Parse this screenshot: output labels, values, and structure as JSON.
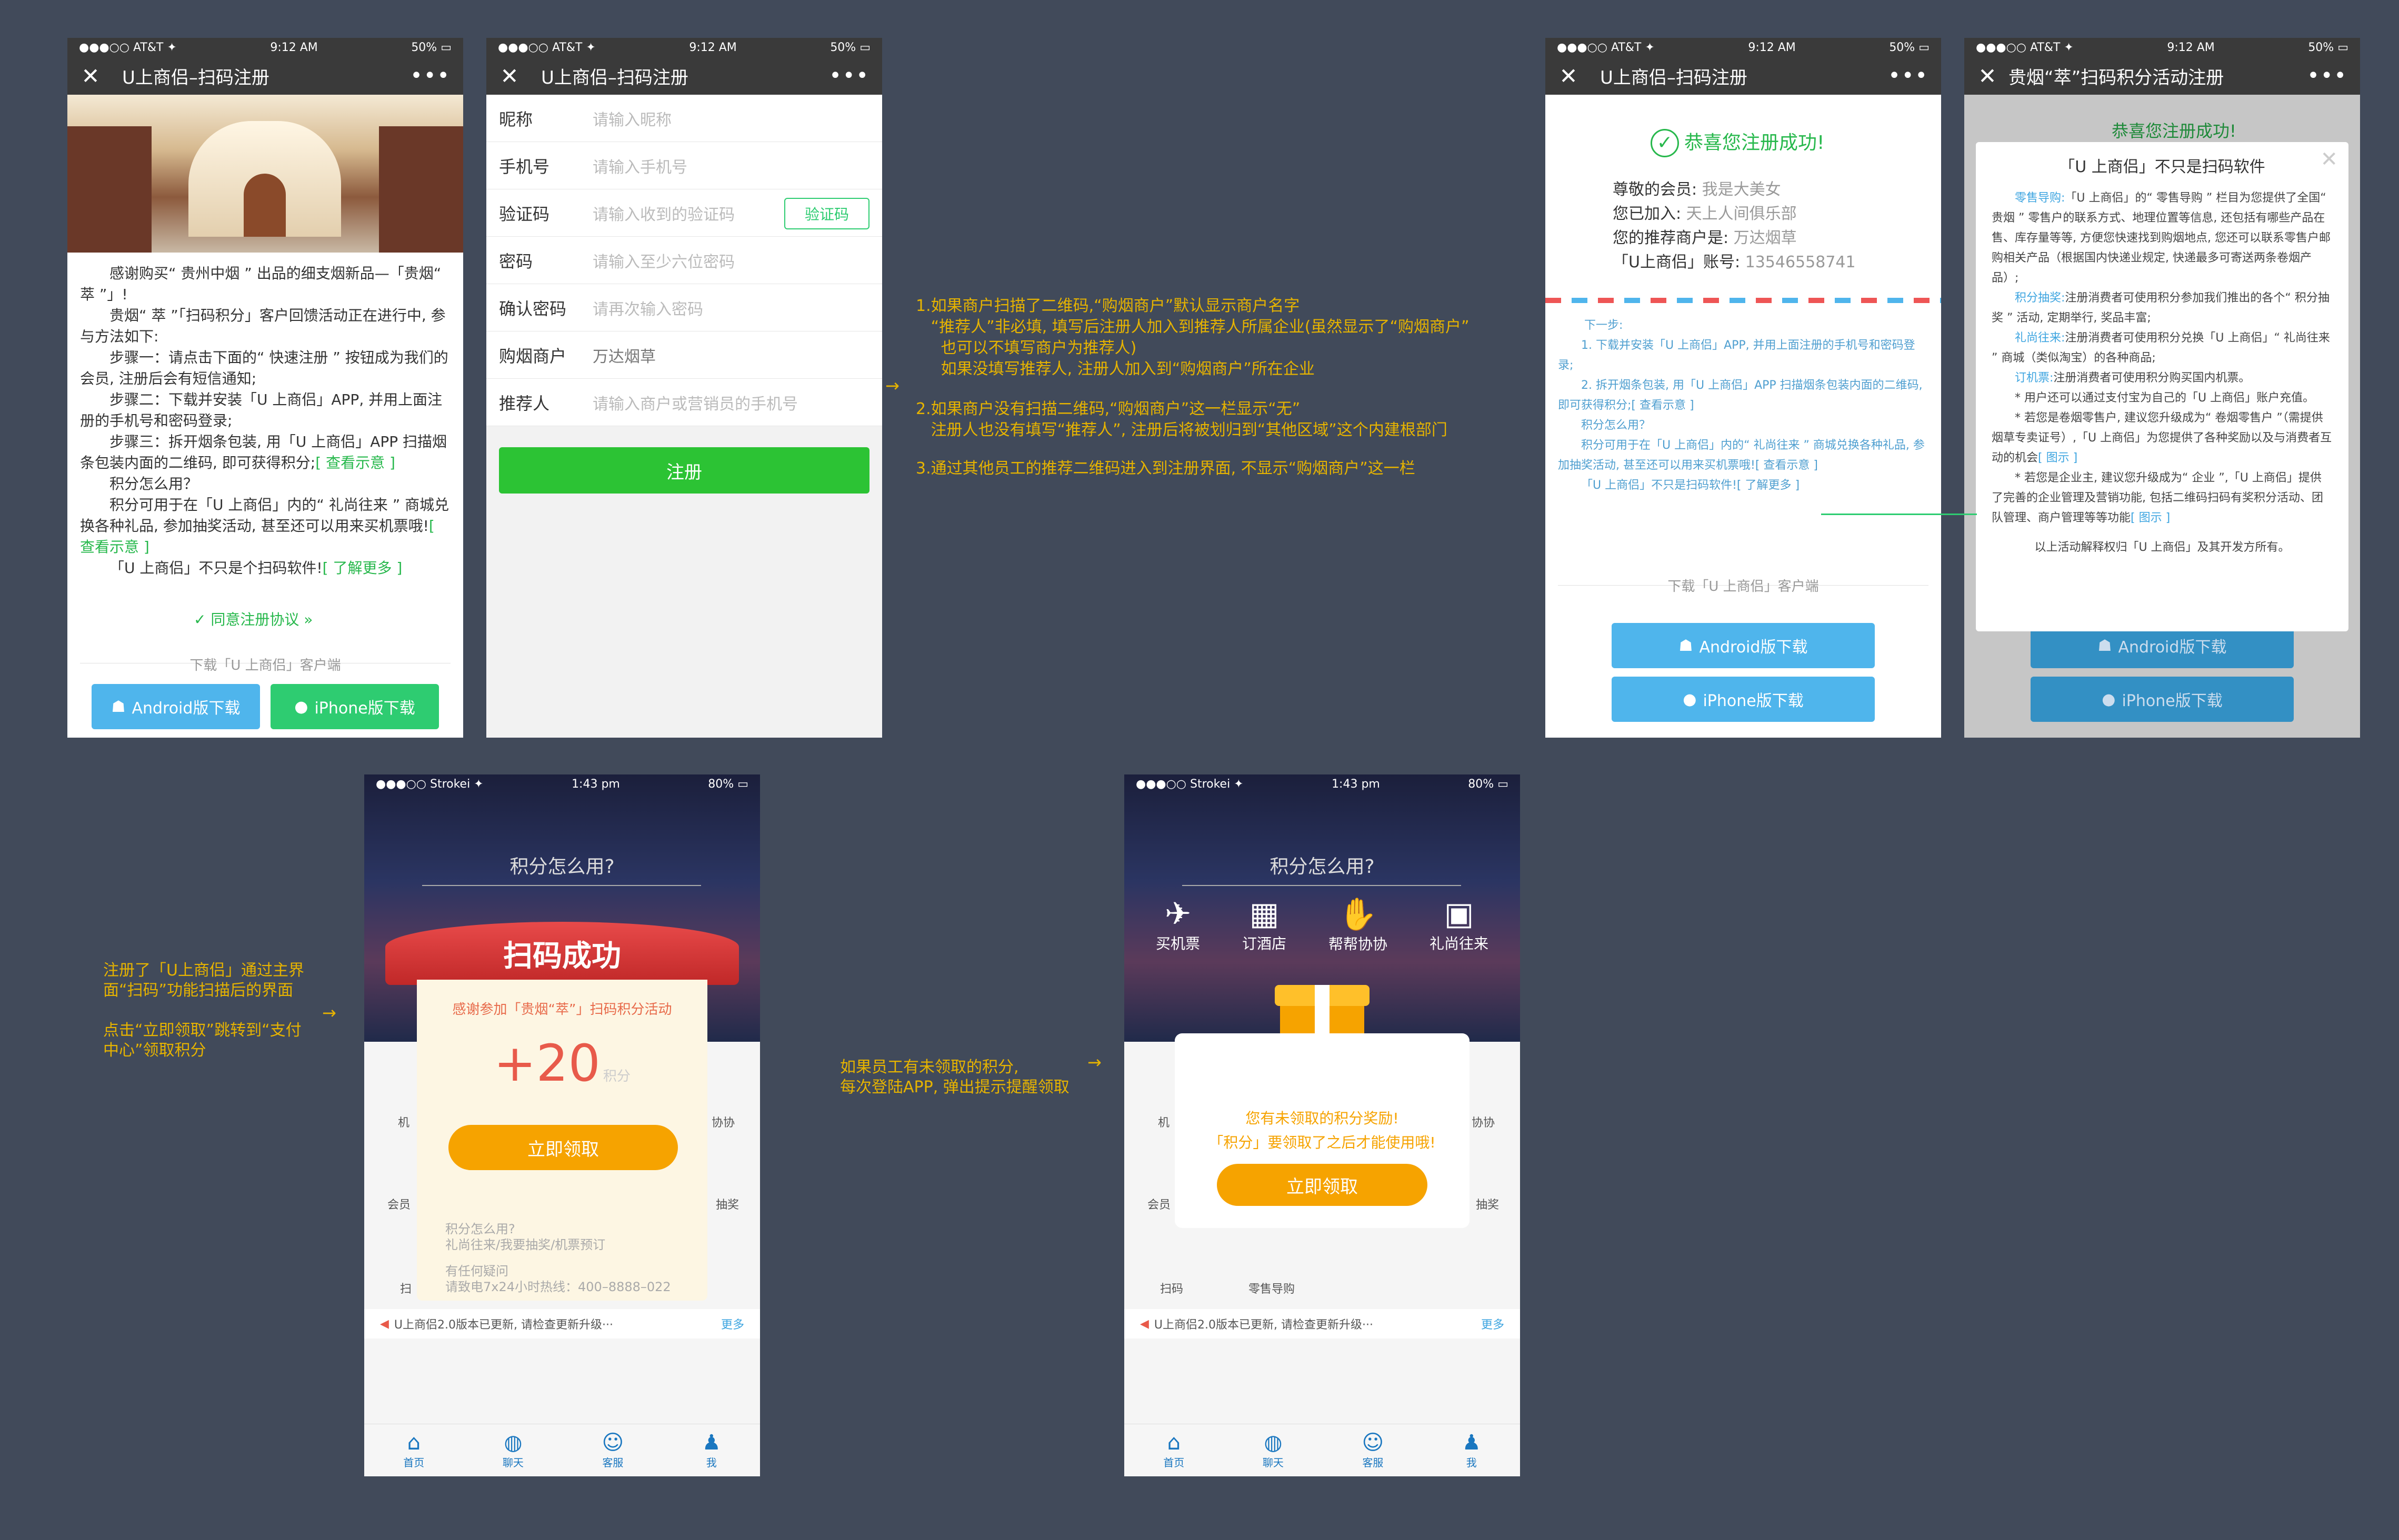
{
  "status": {
    "carrier": "●●●○○ AT&T ✦",
    "time": "9:12 AM",
    "battery": "50% ▭"
  },
  "status2": {
    "carrier": "●●●○○ Strokei ✦",
    "time": "1:43 pm",
    "battery": "80% ▭"
  },
  "p1": {
    "title": "U上商侣–扫码注册",
    "body": [
      "感谢购买“ 贵州中烟 ” 出品的细支烟新品—「贵烟“ 萃 ”」!",
      "贵烟“ 萃 ”「扫码积分」客户回馈活动正在进行中, 参与方法如下:",
      "步骤一：请点击下面的“ 快速注册 ” 按钮成为我们的会员, 注册后会有短信通知;",
      "步骤二：下载并安装「U 上商侣」APP, 并用上面注册的手机号和密码登录;",
      "步骤三：拆开烟条包装, 用「U 上商侣」APP 扫描烟条包装内面的二维码, 即可获得积分;",
      "积分怎么用？",
      "积分可用于在「U 上商侣」内的“ 礼尚往来 ” 商城兑换各种礼品, 参加抽奖活动, 甚至还可以用来买机票哦!",
      "「U 上商侣」不只是个扫码软件!"
    ],
    "link_demo1": "[ 查看示意 ]",
    "link_demo2": "[ 查看示意 ]",
    "link_more": "[ 了解更多 ]",
    "agree": "同意注册协议 »",
    "download_label": "下载「U 上商侣」客户端",
    "android": "Android版下载",
    "iphone": "iPhone版下载"
  },
  "p2": {
    "title": "U上商侣–扫码注册",
    "fields": [
      {
        "label": "昵称",
        "placeholder": "请输入昵称"
      },
      {
        "label": "手机号",
        "placeholder": "请输入手机号"
      },
      {
        "label": "验证码",
        "placeholder": "请输入收到的验证码"
      },
      {
        "label": "密码",
        "placeholder": "请输入至少六位密码"
      },
      {
        "label": "确认密码",
        "placeholder": "请再次输入密码"
      },
      {
        "label": "购烟商户",
        "placeholder": "万达烟草"
      },
      {
        "label": "推荐人",
        "placeholder": "请输入商户或营销员的手机号"
      }
    ],
    "verify_btn": "验证码",
    "submit": "注册"
  },
  "notes": {
    "n1": "1.如果商户扫描了二维码,“购烟商户”默认显示商户名字\n   “推荐人”非必填, 填写后注册人加入到推荐人所属企业(虽然显示了“购烟商户”\n     也可以不填写商户为推荐人)\n     如果没填写推荐人, 注册人加入到“购烟商户”所在企业",
    "n2": "2.如果商户没有扫描二维码,“购烟商户”这一栏显示“无”\n   注册人也没有填写“推荐人”, 注册后将被划归到“其他区域”这个内建根部门",
    "n3": "3.通过其他员工的推荐二维码进入到注册界面, 不显示“购烟商户”这一栏",
    "n4": "注册了「U上商侣」通过主界\n面“扫码”功能扫描后的界面",
    "n5": "点击“立即领取”跳转到“支付\n中心”领取积分",
    "n6": "如果员工有未领取的积分,\n每次登陆APP, 弹出提示提醒领取",
    "arrow": "→"
  },
  "p3": {
    "title": "U上商侣–扫码注册",
    "success": "恭喜您注册成功!",
    "info": [
      {
        "k": "尊敬的会员:",
        "v": "我是大美女"
      },
      {
        "k": "您已加入:",
        "v": "天上人间俱乐部"
      },
      {
        "k": "您的推荐商户是:",
        "v": "万达烟草"
      },
      {
        "k": "「U上商侣」账号:",
        "v": "13546558741"
      }
    ],
    "next": [
      "下一步:",
      "1. 下载并安装「U 上商侣」APP, 并用上面注册的手机号和密码登录;",
      "2. 拆开烟条包装, 用「U 上商侣」APP 扫描烟条包装内面的二维码, 即可获得积分;",
      "积分怎么用？",
      "积分可用于在「U 上商侣」内的“ 礼尚往来 ” 商城兑换各种礼品, 参加抽奖活动, 甚至还可以用来买机票哦!",
      "「U 上商侣」不只是扫码软件!"
    ],
    "demo": "[ 查看示意 ]",
    "demo2": "[ 查看示意 ]",
    "more": "[ 了解更多 ]",
    "download_label": "下载「U 上商侣」客户端",
    "android": "Android版下载",
    "iphone": "iPhone版下载"
  },
  "p4": {
    "title": "贵烟“萃”扫码积分活动注册",
    "behind": "恭喜您注册成功!",
    "modal_title": "「U 上商侣」不只是扫码软件",
    "paras": [
      {
        "h": "零售导购:",
        "t": "「U 上商侣」的“ 零售导购 ” 栏目为您提供了全国“ 贵烟 ” 零售户的联系方式、地理位置等信息, 还包括有哪些产品在售、库存量等等, 方便您快速找到购烟地点, 您还可以联系零售户邮购相关产品（根据国内快递业规定, 快递最多可寄送两条卷烟产品）;"
      },
      {
        "h": "积分抽奖:",
        "t": "注册消费者可使用积分参加我们推出的各个“ 积分抽奖 ” 活动, 定期举行, 奖品丰富;"
      },
      {
        "h": "礼尚往来:",
        "t": "注册消费者可使用积分兑换「U 上商侣」“ 礼尚往来 ” 商城（类似淘宝）的各种商品;"
      },
      {
        "h": "订机票:",
        "t": "注册消费者可使用积分购买国内机票。"
      }
    ],
    "bullets": [
      "* 用户还可以通过支付宝为自己的「U 上商侣」账户充值。",
      "* 若您是卷烟零售户, 建议您升级成为“ 卷烟零售户 ”（需提供烟草专卖证号）,「U 上商侣」为您提供了各种奖励以及与消费者互动的机会",
      "* 若您是企业主, 建议您升级成为“ 企业 ”,「U 上商侣」提供了完善的企业管理及营销功能, 包括二维码扫码有奖积分活动、团队管理、商户管理等等功能"
    ],
    "diagram": "[ 图示 ]",
    "diagram2": "[ 图示 ]",
    "footer": "以上活动解释权归「U 上商侣」及其开发方所有。",
    "android": "Android版下载",
    "iphone": "iPhone版下载"
  },
  "p5": {
    "heading": "积分怎么用?",
    "banner": "扫码成功",
    "thanks": "感谢参加「贵烟“萃”」扫码积分活动",
    "points": "+20",
    "unit": "积分",
    "claim": "立即领取",
    "how": "积分怎么用?",
    "how_sub": "礼尚往来/我要抽奖/机票预订",
    "question": "有任何疑问",
    "hotline": "请致电7x24小时热线：400–8888–022",
    "ticker": "U上商侣2.0版本已更新, 请检查更新升级···",
    "more": "更多",
    "tabs": [
      "首页",
      "聊天",
      "客服",
      "我"
    ],
    "grid": [
      "机",
      "协协",
      "会员",
      "抽奖",
      "扫"
    ]
  },
  "p6": {
    "heading": "积分怎么用?",
    "icons": [
      "买机票",
      "订酒店",
      "帮帮协协",
      "礼尚往来"
    ],
    "msg1": "您有未领取的积分奖励!",
    "msg2": "「积分」要领取了之后才能使用哦!",
    "claim": "立即领取",
    "ticker": "U上商侣2.0版本已更新, 请检查更新升级···",
    "more": "更多",
    "tabs": [
      "首页",
      "聊天",
      "客服",
      "我"
    ],
    "grid": [
      "机",
      "协协",
      "会员",
      "抽奖",
      "扫码",
      "零售导购"
    ]
  },
  "colors": {
    "green": "#27b84c",
    "blue": "#4fb5ec",
    "orange": "#f6a300",
    "dark": "#3a3a3a",
    "bg": "#414a5a",
    "note": "#e6b300"
  }
}
